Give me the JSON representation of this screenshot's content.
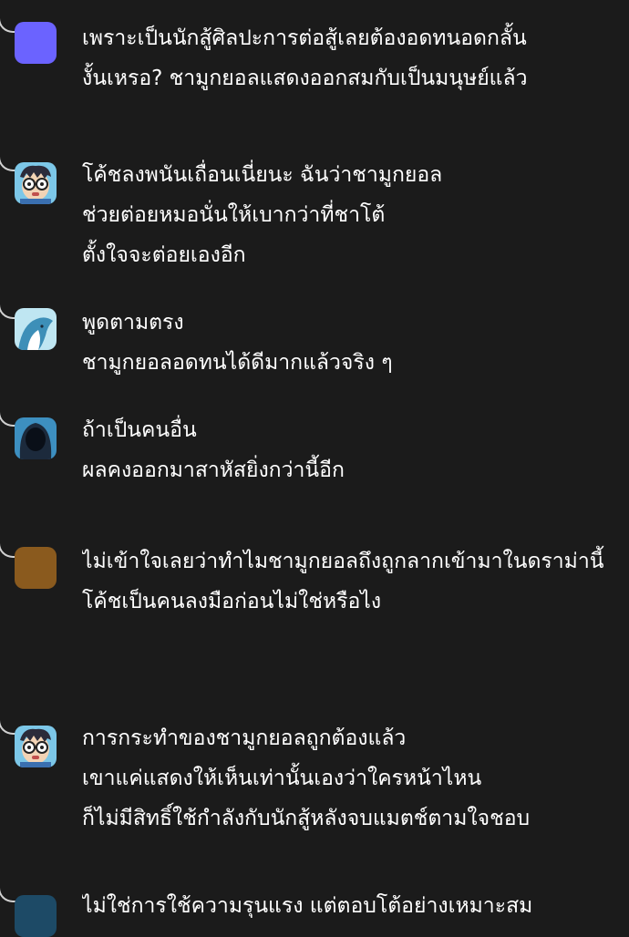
{
  "comments": [
    {
      "avatar": "purple-square-avatar",
      "avatar_color": "#6b63ff",
      "lines": [
        "เพราะเป็นนักสู้ศิลปะการต่อสู้เลยต้องอดทนอดกลั้น",
        "งั้นเหรอ? ชามูกยอลแสดงออกสมกับเป็นมนุษย์แล้ว"
      ]
    },
    {
      "avatar": "cartoon-boy-glasses-avatar",
      "lines": [
        "โค้ชลงพนันเถื่อนเนี่ยนะ ฉันว่าชามูกยอล",
        "ช่วยต่อยหมอนั่นให้เบากว่าที่ชาโต้",
        "ตั้งใจจะต่อยเองอีก"
      ]
    },
    {
      "avatar": "whale-avatar",
      "lines": [
        "พูดตามตรง",
        "ชามูกยอลอดทนได้ดีมากแล้วจริง ๆ"
      ]
    },
    {
      "avatar": "hooded-figure-avatar",
      "lines": [
        "ถ้าเป็นคนอื่น",
        "ผลคงออกมาสาหัสยิ่งกว่านี้อีก"
      ]
    },
    {
      "avatar": "brown-square-avatar",
      "avatar_color": "#8a5a1e",
      "lines": [
        "ไม่เข้าใจเลยว่าทำไมชามูกยอลถึงถูกลากเข้ามาในดราม่านี้",
        "โค้ชเป็นคนลงมือก่อนไม่ใช่หรือไง"
      ]
    },
    {
      "avatar": "cartoon-boy-glasses-avatar",
      "lines": [
        "การกระทำของชามูกยอลถูกต้องแล้ว",
        "เขาแค่แสดงให้เห็นเท่านั้นเองว่าใครหน้าไหน",
        "ก็ไม่มีสิทธิ์ใช้กำลังกับนักสู้หลังจบแมตช์ตามใจชอบ"
      ]
    },
    {
      "avatar": "dark-blue-avatar",
      "avatar_color": "#1d4a66",
      "lines": [
        "ไม่ใช่การใช้ความรุนแรง แต่ตอบโต้อย่างเหมาะสม"
      ]
    }
  ]
}
